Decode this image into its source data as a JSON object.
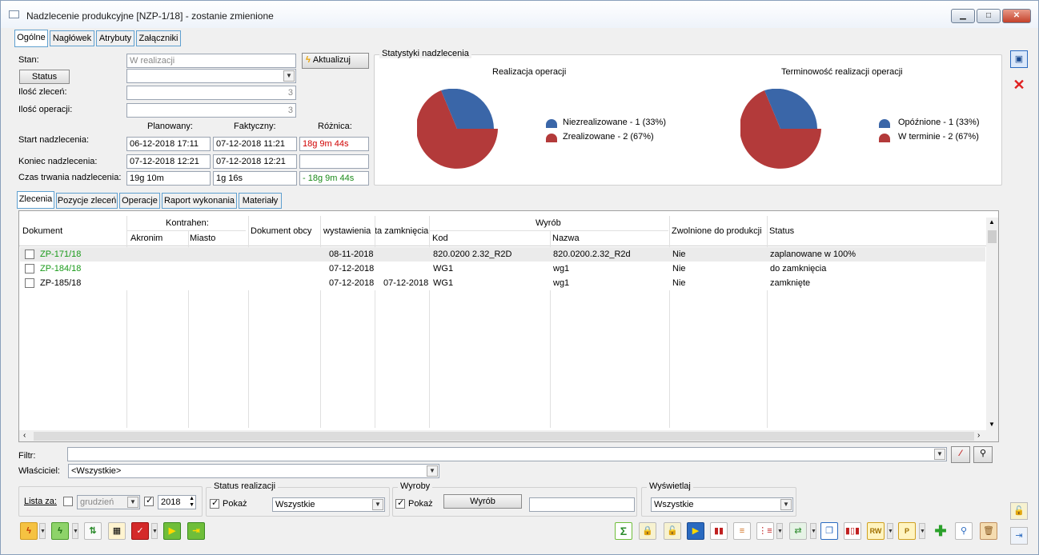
{
  "window": {
    "title": "Nadzlecenie produkcyjne [NZP-1/18] - zostanie zmienione",
    "minimize": "▁",
    "maximize": "□",
    "close": "✕"
  },
  "tabs": [
    {
      "label": "Ogólne"
    },
    {
      "label": "Nagłówek"
    },
    {
      "label": "Atrybuty"
    },
    {
      "label": "Załączniki"
    }
  ],
  "form": {
    "stan_label": "Stan:",
    "stan_value": "W realizacji",
    "aktualizuj": "Aktualizuj",
    "status_button": "Status",
    "status_value": "",
    "ilosc_zlecen_label": "Ilość zleceń:",
    "ilosc_zlecen": "3",
    "ilosc_operacji_label": "Ilość operacji:",
    "ilosc_operacji": "3",
    "col_planowany": "Planowany:",
    "col_faktyczny": "Faktyczny:",
    "col_roznica": "Różnica:",
    "start_label": "Start nadzlecenia:",
    "start_plan": "06-12-2018 17:11",
    "start_fakt": "07-12-2018 11:21",
    "start_roznica": "18g 9m 44s",
    "koniec_label": "Koniec nadzlecenia:",
    "koniec_plan": "07-12-2018 12:21",
    "koniec_fakt": "07-12-2018 12:21",
    "koniec_roznica": "",
    "czas_label": "Czas trwania nadzlecenia:",
    "czas_plan": "19g 10m",
    "czas_fakt": "1g 16s",
    "czas_roznica": "- 18g 9m 44s"
  },
  "stats": {
    "group_label": "Statystyki nadzlecenia",
    "chart1_title": "Realizacja operacji",
    "chart1_leg1": "Niezrealizowane - 1 (33%)",
    "chart1_leg2": "Zrealizowane - 2 (67%)",
    "chart2_title": "Terminowość realizacji operacji",
    "chart2_leg1": "Opóźnione - 1 (33%)",
    "chart2_leg2": "W terminie - 2 (67%)"
  },
  "chart_data": [
    {
      "type": "pie",
      "title": "Realizacja operacji",
      "categories": [
        "Niezrealizowane",
        "Zrealizowane"
      ],
      "values": [
        1,
        2
      ],
      "percent": [
        33,
        67
      ],
      "colors": [
        "#3a66a8",
        "#b33a3a"
      ]
    },
    {
      "type": "pie",
      "title": "Terminowość realizacji operacji",
      "categories": [
        "Opóźnione",
        "W terminie"
      ],
      "values": [
        1,
        2
      ],
      "percent": [
        33,
        67
      ],
      "colors": [
        "#3a66a8",
        "#b33a3a"
      ]
    }
  ],
  "subtabs": [
    {
      "label": "Zlecenia"
    },
    {
      "label": "Pozycje zleceń"
    },
    {
      "label": "Operacje"
    },
    {
      "label": "Raport wykonania"
    },
    {
      "label": "Materiały"
    }
  ],
  "grid": {
    "headers": {
      "dokument": "Dokument",
      "kontrahen": "Kontrahen:",
      "akronim": "Akronim",
      "miasto": "Miasto",
      "dokument_obcy": "Dokument obcy",
      "wystawienia": "wystawienia",
      "zamkniecia": "ta zamknięcia",
      "wyrob": "Wyrób",
      "kod": "Kod",
      "nazwa": "Nazwa",
      "zwolnione": "Zwolnione do produkcji",
      "status": "Status"
    },
    "rows": [
      {
        "dokument": "ZP-171/18",
        "wystawienia": "08-11-2018",
        "zamkniecia": "",
        "kod": "820.0200 2.32_R2D",
        "nazwa": "820.0200.2.32_R2d",
        "zwolnione": "Nie",
        "status": "zaplanowane w 100%",
        "color": "#1a9a1a"
      },
      {
        "dokument": "ZP-184/18",
        "wystawienia": "07-12-2018",
        "zamkniecia": "",
        "kod": "WG1",
        "nazwa": "wg1",
        "zwolnione": "Nie",
        "status": "do zamknięcia",
        "color": "#1a9a1a"
      },
      {
        "dokument": "ZP-185/18",
        "wystawienia": "07-12-2018",
        "zamkniecia": "07-12-2018",
        "kod": "WG1",
        "nazwa": "wg1",
        "zwolnione": "Nie",
        "status": "zamknięte",
        "color": "#000000"
      }
    ]
  },
  "filters": {
    "filtr_label": "Filtr:",
    "filtr_value": "",
    "wlasciciel_label": "Właściciel:",
    "wlasciciel_value": "<Wszystkie>",
    "lista_za_label": "Lista za:",
    "month": "grudzień",
    "year": "2018",
    "status_group": "Status realizacji",
    "pokaz": "Pokaż",
    "status_value": "Wszystkie",
    "wyroby_group": "Wyroby",
    "wyroby_pokaz": "Pokaż",
    "wyrob_button": "Wyrób",
    "wyrob_value": "",
    "wyswietlaj_group": "Wyświetlaj",
    "wyswietlaj_value": "Wszystkie"
  },
  "icons": {
    "sigma": "Σ",
    "plus": "✚",
    "search": "🔍"
  }
}
